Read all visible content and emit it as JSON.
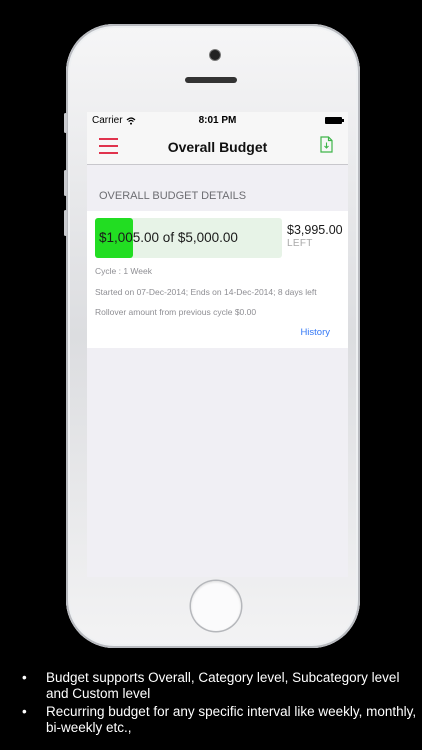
{
  "status_bar": {
    "carrier": "Carrier",
    "time": "8:01 PM"
  },
  "nav": {
    "title": "Overall Budget",
    "left_icon": "menu-icon",
    "right_icon": "document-icon"
  },
  "section": {
    "header": "OVERALL BUDGET DETAILS"
  },
  "budget": {
    "progress_text": "$1,005.00 of $5,000.00",
    "progress_fraction": 0.201,
    "left_amount": "$3,995.00",
    "left_label": "LEFT",
    "cycle": "Cycle : 1 Week",
    "dates": "Started on 07-Dec-2014; Ends on 14-Dec-2014; 8 days left",
    "rollover": "Rollover amount from previous cycle $0.00",
    "history_link": "History"
  },
  "captions": [
    "Budget supports Overall, Category level, Subcategory level and Custom level",
    "Recurring budget for any specific interval like weekly, monthly, bi-weekly etc.,"
  ],
  "colors": {
    "accent": "#e0334d",
    "progress_fill": "#22dd22",
    "link": "#3478f6",
    "doc_icon": "#3fb54a"
  }
}
